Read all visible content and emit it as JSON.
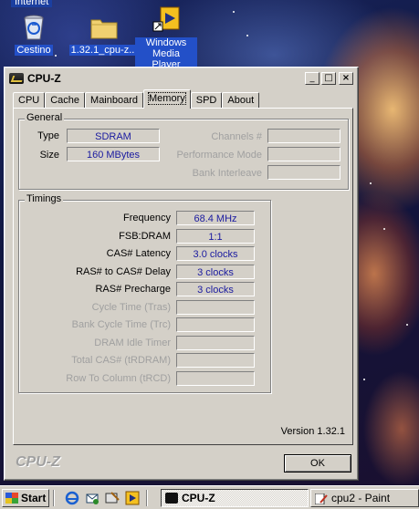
{
  "desktop": {
    "top_label": "Internet",
    "icons": [
      {
        "label": "Cestino",
        "selected": true
      },
      {
        "label": "1.32.1_cpu-z...",
        "selected": true
      },
      {
        "label": "Windows Media Player",
        "label_line1": "Windows",
        "label_line2": "Media Player",
        "selected": true
      }
    ]
  },
  "window": {
    "title": "CPU-Z",
    "buttons": {
      "minimize": "_",
      "maximize": "□",
      "close": "×"
    },
    "tabs": [
      {
        "label": "CPU",
        "active": false
      },
      {
        "label": "Cache",
        "active": false
      },
      {
        "label": "Mainboard",
        "active": false
      },
      {
        "label": "Memory",
        "active": true
      },
      {
        "label": "SPD",
        "active": false
      },
      {
        "label": "About",
        "active": false
      }
    ],
    "general": {
      "title": "General",
      "type_label": "Type",
      "type_value": "SDRAM",
      "size_label": "Size",
      "size_value": "160 MBytes",
      "channels_label": "Channels #",
      "channels_value": "",
      "perf_mode_label": "Performance Mode",
      "perf_mode_value": "",
      "bank_interleave_label": "Bank Interleave",
      "bank_interleave_value": ""
    },
    "timings": {
      "title": "Timings",
      "rows": [
        {
          "label": "Frequency",
          "value": "68.4 MHz",
          "enabled": true
        },
        {
          "label": "FSB:DRAM",
          "value": "1:1",
          "enabled": true
        },
        {
          "label": "CAS# Latency",
          "value": "3.0 clocks",
          "enabled": true
        },
        {
          "label": "RAS# to CAS# Delay",
          "value": "3 clocks",
          "enabled": true
        },
        {
          "label": "RAS# Precharge",
          "value": "3 clocks",
          "enabled": true
        },
        {
          "label": "Cycle Time (Tras)",
          "value": "",
          "enabled": false
        },
        {
          "label": "Bank Cycle Time (Trc)",
          "value": "",
          "enabled": false
        },
        {
          "label": "DRAM Idle Timer",
          "value": "",
          "enabled": false
        },
        {
          "label": "Total CAS# (tRDRAM)",
          "value": "",
          "enabled": false
        },
        {
          "label": "Row To Column (tRCD)",
          "value": "",
          "enabled": false
        }
      ]
    },
    "version": "Version 1.32.1",
    "brand": "CPU-Z",
    "ok_label": "OK"
  },
  "taskbar": {
    "start_label": "Start",
    "tasks": [
      {
        "label": "CPU-Z",
        "pressed": true
      },
      {
        "label": "cpu2 - Paint",
        "pressed": false
      }
    ]
  }
}
